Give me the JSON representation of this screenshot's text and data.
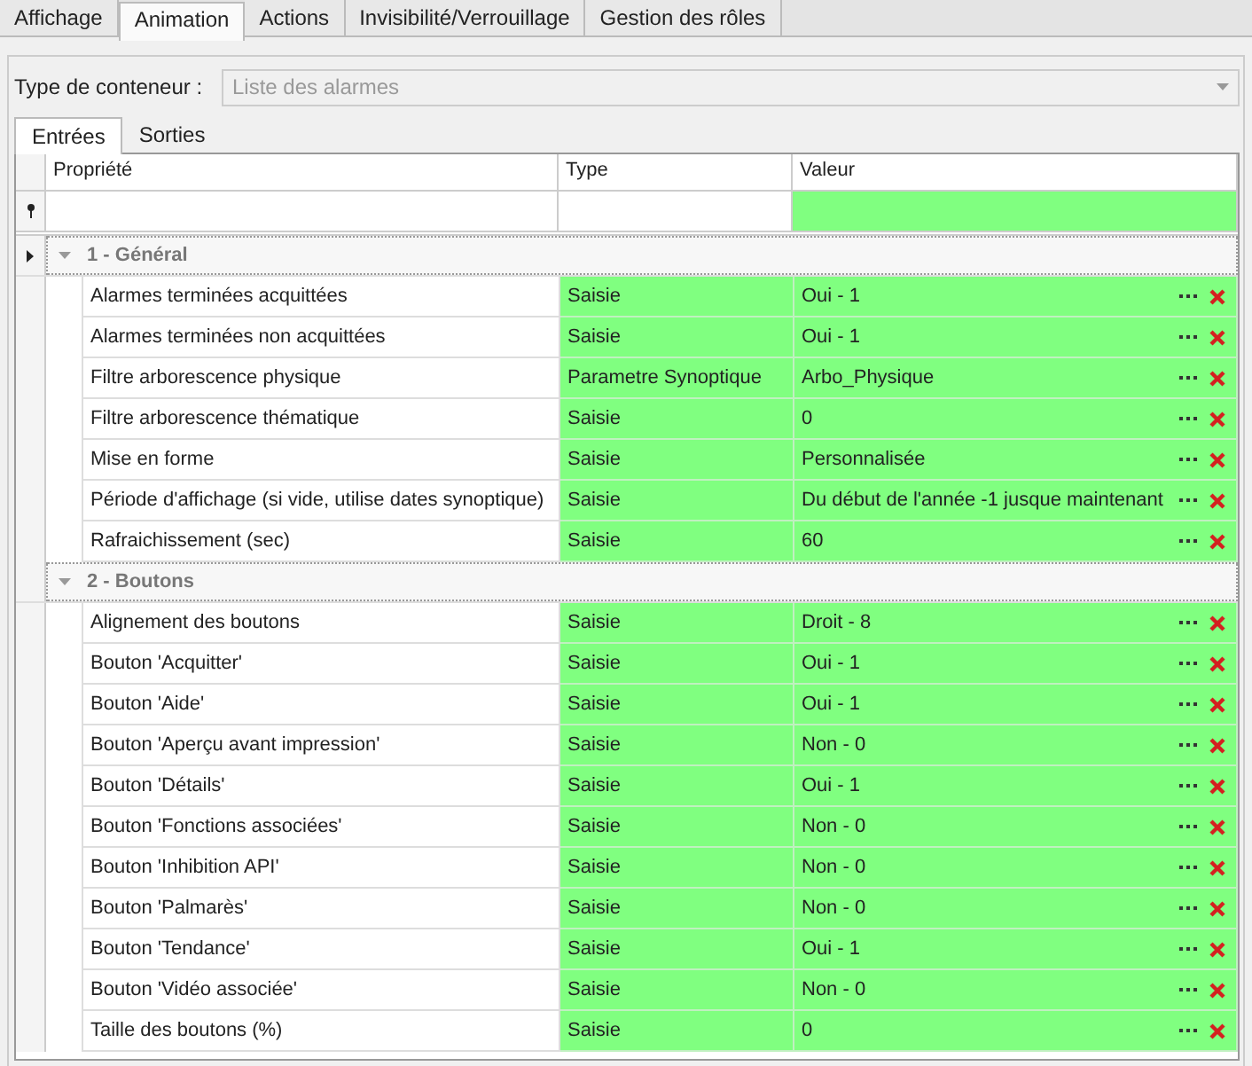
{
  "tabs": [
    {
      "label": "Affichage",
      "selected": false
    },
    {
      "label": "Animation",
      "selected": true
    },
    {
      "label": "Actions",
      "selected": false
    },
    {
      "label": "Invisibilité/Verrouillage",
      "selected": false
    },
    {
      "label": "Gestion des rôles",
      "selected": false
    }
  ],
  "container": {
    "label": "Type de conteneur :",
    "value": "Liste des alarmes",
    "disabled": true
  },
  "subtabs": [
    {
      "label": "Entrées",
      "selected": true
    },
    {
      "label": "Sorties",
      "selected": false
    }
  ],
  "grid": {
    "columns": [
      "Propriété",
      "Type",
      "Valeur"
    ],
    "groups": [
      {
        "title": "1 - Général",
        "expanded": true,
        "selected": true,
        "rows": [
          {
            "property": "Alarmes terminées acquittées",
            "type": "Saisie",
            "value": "Oui - 1"
          },
          {
            "property": "Alarmes terminées non acquittées",
            "type": "Saisie",
            "value": "Oui - 1"
          },
          {
            "property": "Filtre arborescence physique",
            "type": "Parametre Synoptique",
            "value": "Arbo_Physique"
          },
          {
            "property": "Filtre arborescence thématique",
            "type": "Saisie",
            "value": "0"
          },
          {
            "property": "Mise en forme",
            "type": "Saisie",
            "value": "Personnalisée"
          },
          {
            "property": "Période d'affichage (si vide, utilise dates synoptique)",
            "type": "Saisie",
            "value": "Du début de l'année -1 jusque maintenant"
          },
          {
            "property": "Rafraichissement (sec)",
            "type": "Saisie",
            "value": "60"
          }
        ]
      },
      {
        "title": "2 - Boutons",
        "expanded": true,
        "selected": false,
        "rows": [
          {
            "property": "Alignement des boutons",
            "type": "Saisie",
            "value": "Droit - 8"
          },
          {
            "property": "Bouton 'Acquitter'",
            "type": "Saisie",
            "value": "Oui - 1"
          },
          {
            "property": "Bouton 'Aide'",
            "type": "Saisie",
            "value": "Oui - 1"
          },
          {
            "property": "Bouton 'Aperçu avant impression'",
            "type": "Saisie",
            "value": "Non - 0"
          },
          {
            "property": "Bouton 'Détails'",
            "type": "Saisie",
            "value": "Oui - 1"
          },
          {
            "property": "Bouton 'Fonctions associées'",
            "type": "Saisie",
            "value": "Non - 0"
          },
          {
            "property": "Bouton 'Inhibition API'",
            "type": "Saisie",
            "value": "Non - 0"
          },
          {
            "property": "Bouton 'Palmarès'",
            "type": "Saisie",
            "value": "Non - 0"
          },
          {
            "property": "Bouton 'Tendance'",
            "type": "Saisie",
            "value": "Oui - 1"
          },
          {
            "property": "Bouton 'Vidéo associée'",
            "type": "Saisie",
            "value": "Non - 0"
          },
          {
            "property": "Taille des boutons (%)",
            "type": "Saisie",
            "value": "0"
          }
        ]
      }
    ]
  }
}
